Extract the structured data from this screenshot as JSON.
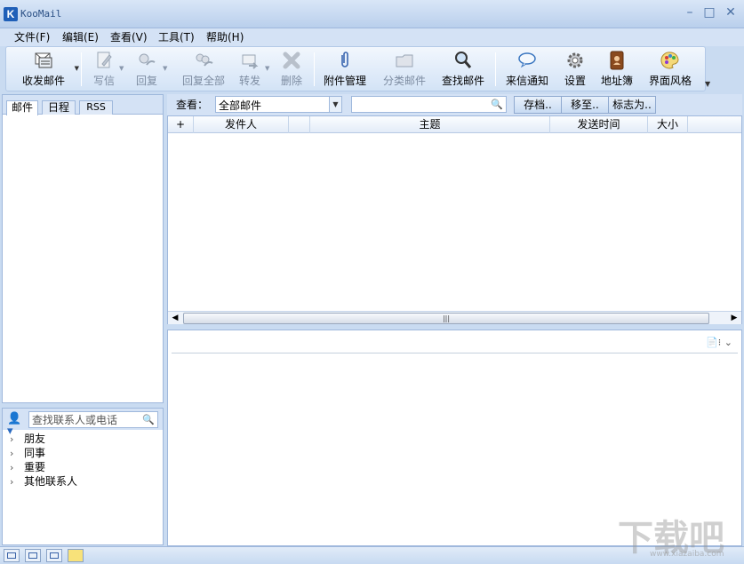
{
  "window": {
    "title": "KooMail",
    "logo_letter": "K",
    "minimize": "–",
    "maximize": "□",
    "close": "✕"
  },
  "menu": [
    {
      "label": "文件(F)"
    },
    {
      "label": "编辑(E)"
    },
    {
      "label": "查看(V)"
    },
    {
      "label": "工具(T)"
    },
    {
      "label": "帮助(H)"
    }
  ],
  "toolbar": {
    "send_receive": "收发邮件",
    "compose": "写信",
    "reply": "回复",
    "reply_all": "回复全部",
    "forward": "转发",
    "delete": "删除",
    "attachments": "附件管理",
    "classify": "分类邮件",
    "find": "查找邮件",
    "notify": "来信通知",
    "settings": "设置",
    "address_book": "地址簿",
    "skin": "界面风格"
  },
  "left_tabs": [
    {
      "label": "邮件"
    },
    {
      "label": "日程"
    },
    {
      "label": "RSS"
    }
  ],
  "contacts": {
    "search_placeholder": "查找联系人或电话",
    "groups": [
      "朋友",
      "同事",
      "重要",
      "其他联系人"
    ]
  },
  "view_bar": {
    "label": "查看：",
    "folder": "全部邮件",
    "archive": "存档..",
    "move_to": "移至..",
    "flag_as": "标志为.."
  },
  "mail_list": {
    "columns": [
      "+",
      "发件人",
      "",
      "主题",
      "发送时间",
      "大小"
    ]
  },
  "watermark": {
    "text": "下载吧",
    "url": "www.xiazaiba.com"
  }
}
